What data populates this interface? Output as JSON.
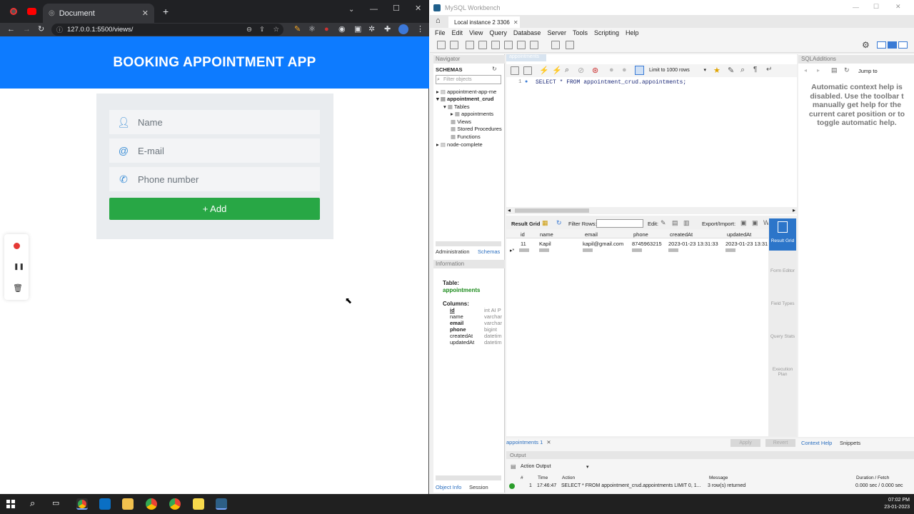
{
  "browser": {
    "tab_title": "Document",
    "url": "127.0.0.1:5500/views/"
  },
  "app": {
    "header": "BOOKING APPOINTMENT APP",
    "name_placeholder": "Name",
    "email_placeholder": "E-mail",
    "phone_placeholder": "Phone number",
    "add_label": "+ Add"
  },
  "workbench": {
    "window_title": "MySQL Workbench",
    "instance_tab": "Local instance 2 3306",
    "menu": [
      "File",
      "Edit",
      "View",
      "Query",
      "Database",
      "Server",
      "Tools",
      "Scripting",
      "Help"
    ],
    "navigator_label": "Navigator",
    "schemas_label": "SCHEMAS",
    "filter_placeholder": "Filter objects",
    "schemas": [
      "appointment-app-me",
      "appointment_crud",
      "Tables",
      "appointments",
      "Views",
      "Stored Procedures",
      "Functions",
      "node-complete"
    ],
    "admin_tab": "Administration",
    "schemas_tab": "Schemas",
    "information_label": "Information",
    "info": {
      "table_label": "Table:",
      "table_name": "appointments",
      "columns_label": "Columns:",
      "columns": [
        {
          "name": "id",
          "type": "int AI P"
        },
        {
          "name": "name",
          "type": "varchar"
        },
        {
          "name": "email",
          "type": "varchar"
        },
        {
          "name": "phone",
          "type": "bigint"
        },
        {
          "name": "createdAt",
          "type": "datetim"
        },
        {
          "name": "updatedAt",
          "type": "datetim"
        }
      ]
    },
    "editor_tab": "appointments",
    "limit_label": "Limit to 1000 rows",
    "line_no": "1",
    "query": "SELECT * FROM appointment_crud.appointments;",
    "result_grid_label": "Result Grid",
    "filter_rows_label": "Filter Rows:",
    "edit_label": "Edit:",
    "export_label": "Export/Import:",
    "result_columns": [
      "id",
      "name",
      "email",
      "phone",
      "createdAt",
      "updatedAt"
    ],
    "result_row": [
      "11",
      "Kapil",
      "kapil@gmail.com",
      "8745963215",
      "2023-01-23 13:31:33",
      "2023-01-23 13:31:3"
    ],
    "side_buttons": [
      "Result Grid",
      "Form Editor",
      "Field Types",
      "Query Stats",
      "Execution Plan"
    ],
    "sql_additions_label": "SQLAdditions",
    "jump_to_label": "Jump to",
    "context_help": "Automatic context help is disabled. Use the toolbar t manually get help for the current caret position or to toggle automatic help.",
    "bottom_tab": "appointments 1",
    "apply_label": "Apply",
    "revert_label": "Revert",
    "context_help_tab": "Context Help",
    "snippets_tab": "Snippets",
    "output_label": "Output",
    "action_output_label": "Action Output",
    "output_headers": [
      "#",
      "Time",
      "Action",
      "Message",
      "Duration / Fetch"
    ],
    "output_row": [
      "1",
      "17:46:47",
      "SELECT * FROM appointment_crud.appointments LIMIT 0, 1...",
      "3 row(s) returned",
      "0.000 sec / 0.000 sec"
    ],
    "object_info_tab": "Object Info",
    "session_tab": "Session"
  },
  "taskbar": {
    "time": "07:02 PM",
    "date": "23-01-2023"
  }
}
